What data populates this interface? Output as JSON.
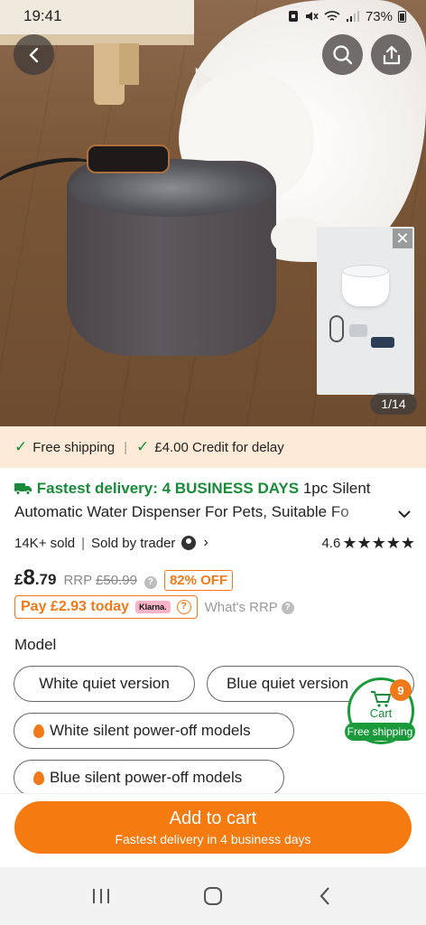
{
  "status_bar": {
    "time": "19:41",
    "battery": "73%"
  },
  "gallery": {
    "counter": "1/14",
    "close_glyph": "✕"
  },
  "shipping_strip": {
    "free_shipping": "Free shipping",
    "credit": "£4.00 Credit for delay"
  },
  "product": {
    "fastest": "Fastest delivery: 4 BUSINESS DAYS",
    "title_part1": " 1pc Silent",
    "title_part2": "Automatic Water Dispenser For Pets, Suitable Fo",
    "sold": "14K+ sold",
    "seller": "Sold by trader",
    "rating": "4.6",
    "rating_value": 4.6,
    "stars": "★★★★★"
  },
  "pricing": {
    "currency": "£",
    "price_int": "8",
    "price_dec": ".79",
    "rrp_label": "RRP",
    "rrp_value": "£50.99",
    "discount": "82% OFF",
    "pay_today": "Pay £2.93 today",
    "klarna": "Klarna.",
    "whats_rrp": "What's RRP"
  },
  "model": {
    "label": "Model",
    "options": [
      "White quiet version",
      "Blue quiet version",
      "White silent power-off models",
      "Blue silent power-off models"
    ]
  },
  "cart": {
    "count": "9",
    "label": "Cart",
    "free_shipping": "Free shipping"
  },
  "add_to_cart": {
    "label": "Add to cart",
    "sub": "Fastest delivery in 4 business days"
  },
  "colors": {
    "accent": "#f57a10",
    "green": "#1a8a3a",
    "strip_bg": "#fdebd8"
  }
}
